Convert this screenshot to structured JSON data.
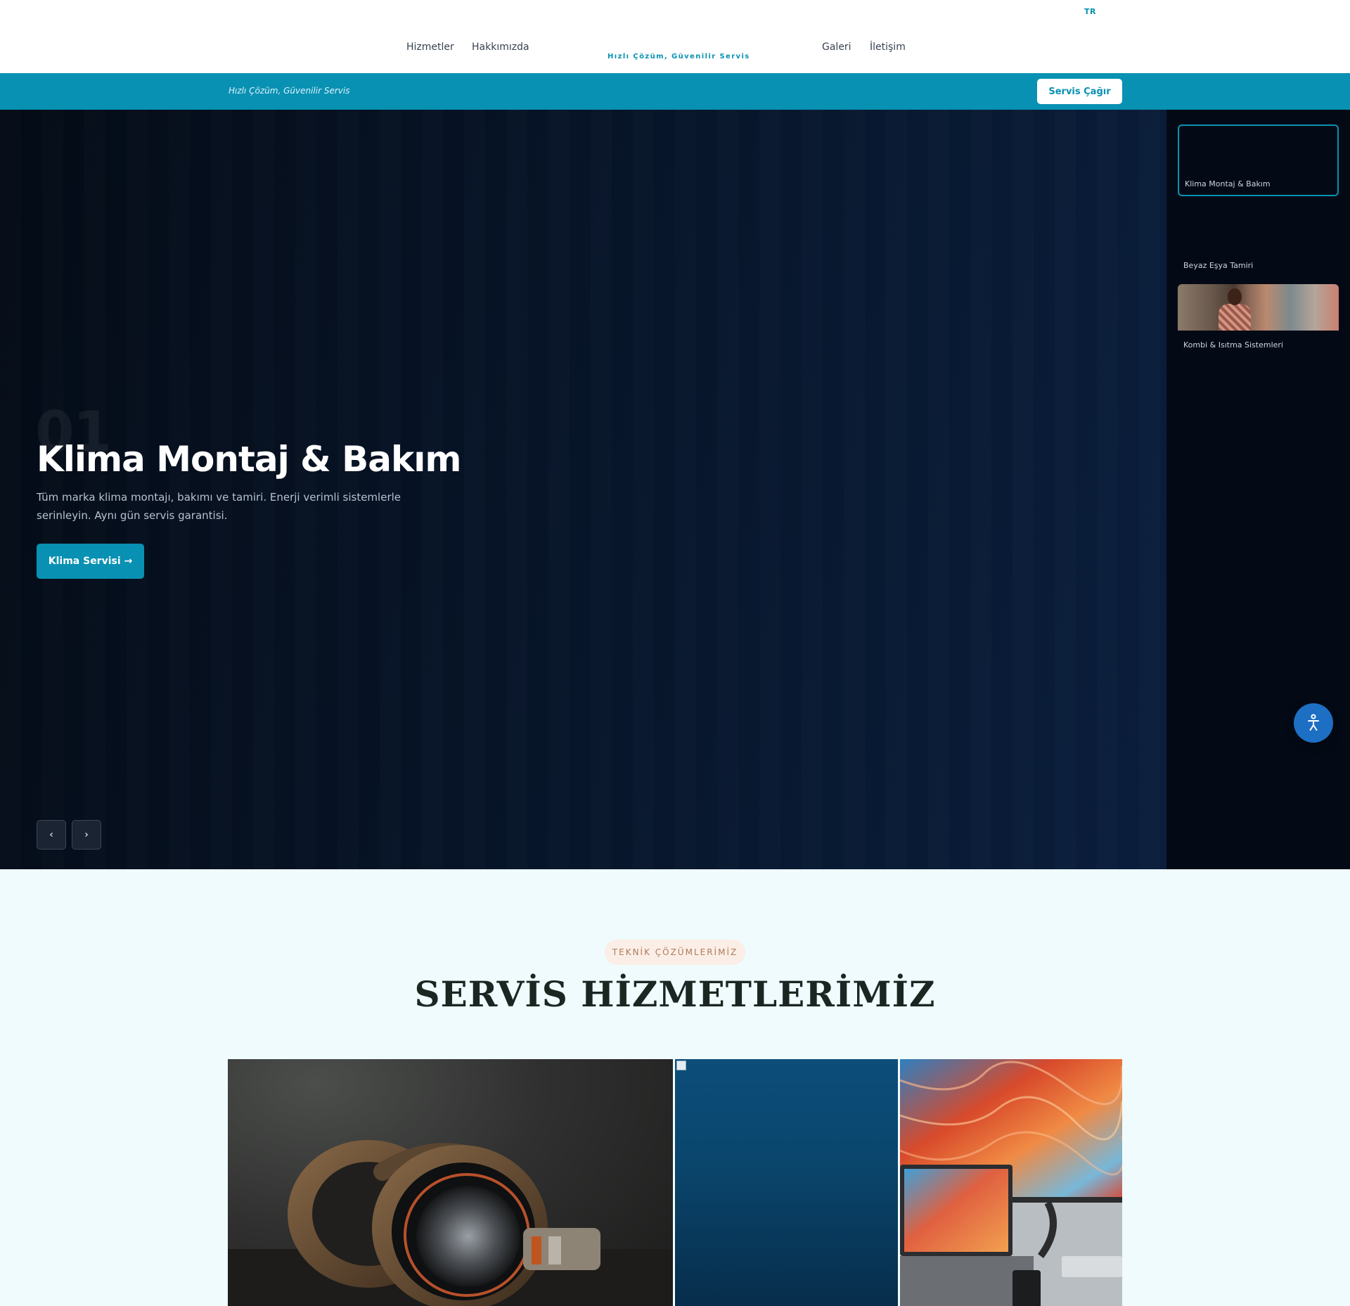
{
  "header": {
    "lang": "TR",
    "nav_left": [
      "Hizmetler",
      "Hakkımızda"
    ],
    "tagline": "Hızlı Çözüm, Güvenilir Servis",
    "nav_right": [
      "Galeri",
      "İletişim"
    ]
  },
  "topbar": {
    "tagline": "Hızlı Çözüm, Güvenilir Servis",
    "call_button": "Servis Çağır"
  },
  "hero": {
    "slide_number": "01",
    "title": "Klima Montaj & Bakım",
    "description": "Tüm marka klima montajı, bakımı ve tamiri. Enerji verimli sistemlerle serinleyin. Aynı gün servis garantisi.",
    "cta": "Klima Servisi →",
    "prev": "‹",
    "next": "›"
  },
  "thumbnails": [
    {
      "label": "Klima Montaj & Bakım",
      "active": true
    },
    {
      "label": "Beyaz Eşya Tamiri",
      "active": false
    },
    {
      "label": "Kombi & Isıtma Sistemleri",
      "active": false
    }
  ],
  "services": {
    "badge": "TEKNİK ÇÖZÜMLERİMİZ",
    "title": "SERVİS HİZMETLERİMİZ"
  },
  "colors": {
    "brand": "#0891b2",
    "hero_dark": "#040b16",
    "section_bg": "#effbfc",
    "accessibility": "#1d6fc4"
  },
  "icons": {
    "accessibility": "accessibility-icon"
  }
}
